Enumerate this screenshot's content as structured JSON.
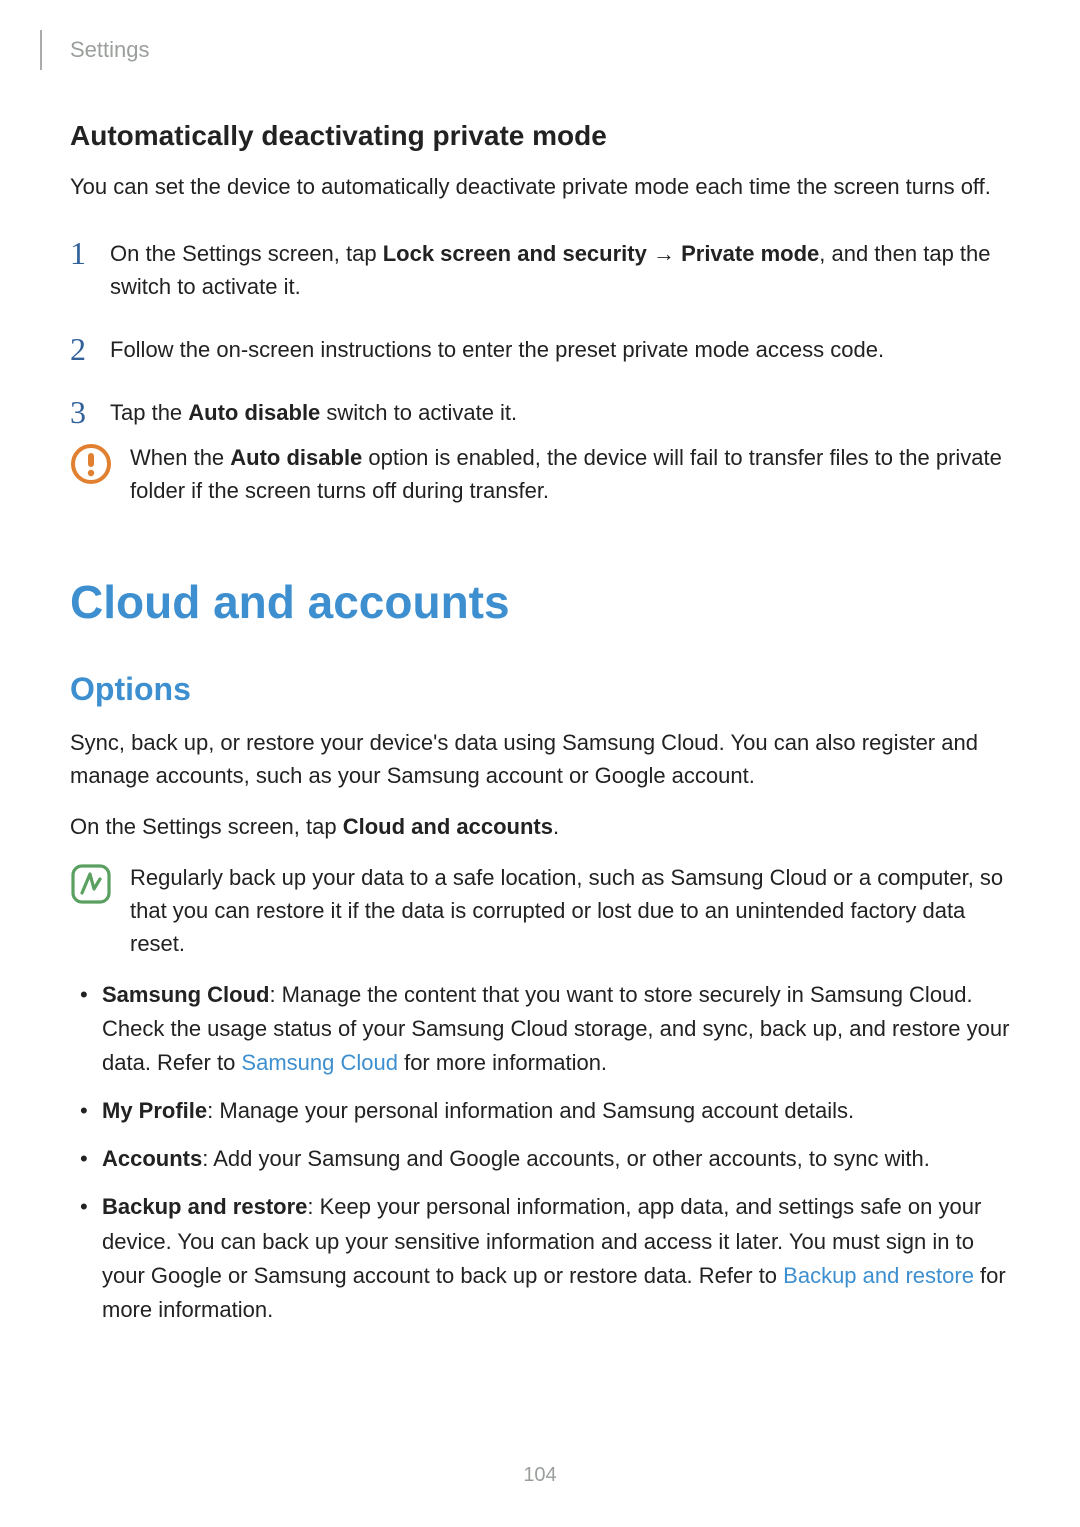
{
  "breadcrumb": "Settings",
  "section_a": {
    "heading": "Automatically deactivating private mode",
    "intro": "You can set the device to automatically deactivate private mode each time the screen turns off.",
    "steps": {
      "1": {
        "prefix": "On the Settings screen, tap ",
        "bold1": "Lock screen and security",
        "arrow": " → ",
        "bold2": "Private mode",
        "suffix": ", and then tap the switch to activate it."
      },
      "2": {
        "text": "Follow the on-screen instructions to enter the preset private mode access code."
      },
      "3": {
        "prefix": "Tap the ",
        "bold": "Auto disable",
        "suffix": " switch to activate it."
      }
    },
    "warning": {
      "p1": "When the ",
      "bold": "Auto disable",
      "p2": " option is enabled, the device will fail to transfer files to the private folder if the screen turns off during transfer."
    }
  },
  "section_b": {
    "title": "Cloud and accounts",
    "subheading": "Options",
    "intro": "Sync, back up, or restore your device's data using Samsung Cloud. You can also register and manage accounts, such as your Samsung account or Google account.",
    "instruction_pre": "On the Settings screen, tap ",
    "instruction_bold": "Cloud and accounts",
    "instruction_post": ".",
    "note": "Regularly back up your data to a safe location, such as Samsung Cloud or a computer, so that you can restore it if the data is corrupted or lost due to an unintended factory data reset.",
    "items": {
      "samsung_cloud": {
        "label": "Samsung Cloud",
        "text_pre": ": Manage the content that you want to store securely in Samsung Cloud. Check the usage status of your Samsung Cloud storage, and sync, back up, and restore your data. Refer to ",
        "link": "Samsung Cloud",
        "text_post": " for more information."
      },
      "my_profile": {
        "label": "My Profile",
        "text": ": Manage your personal information and Samsung account details."
      },
      "accounts": {
        "label": "Accounts",
        "text": ": Add your Samsung and Google accounts, or other accounts, to sync with."
      },
      "backup_restore": {
        "label": "Backup and restore",
        "text_pre": ": Keep your personal information, app data, and settings safe on your device. You can back up your sensitive information and access it later. You must sign in to your Google or Samsung account to back up or restore data. Refer to ",
        "link": "Backup and restore",
        "text_post": " for more information."
      }
    }
  },
  "page_number": "104",
  "step_numbers": {
    "s1": "1",
    "s2": "2",
    "s3": "3"
  }
}
